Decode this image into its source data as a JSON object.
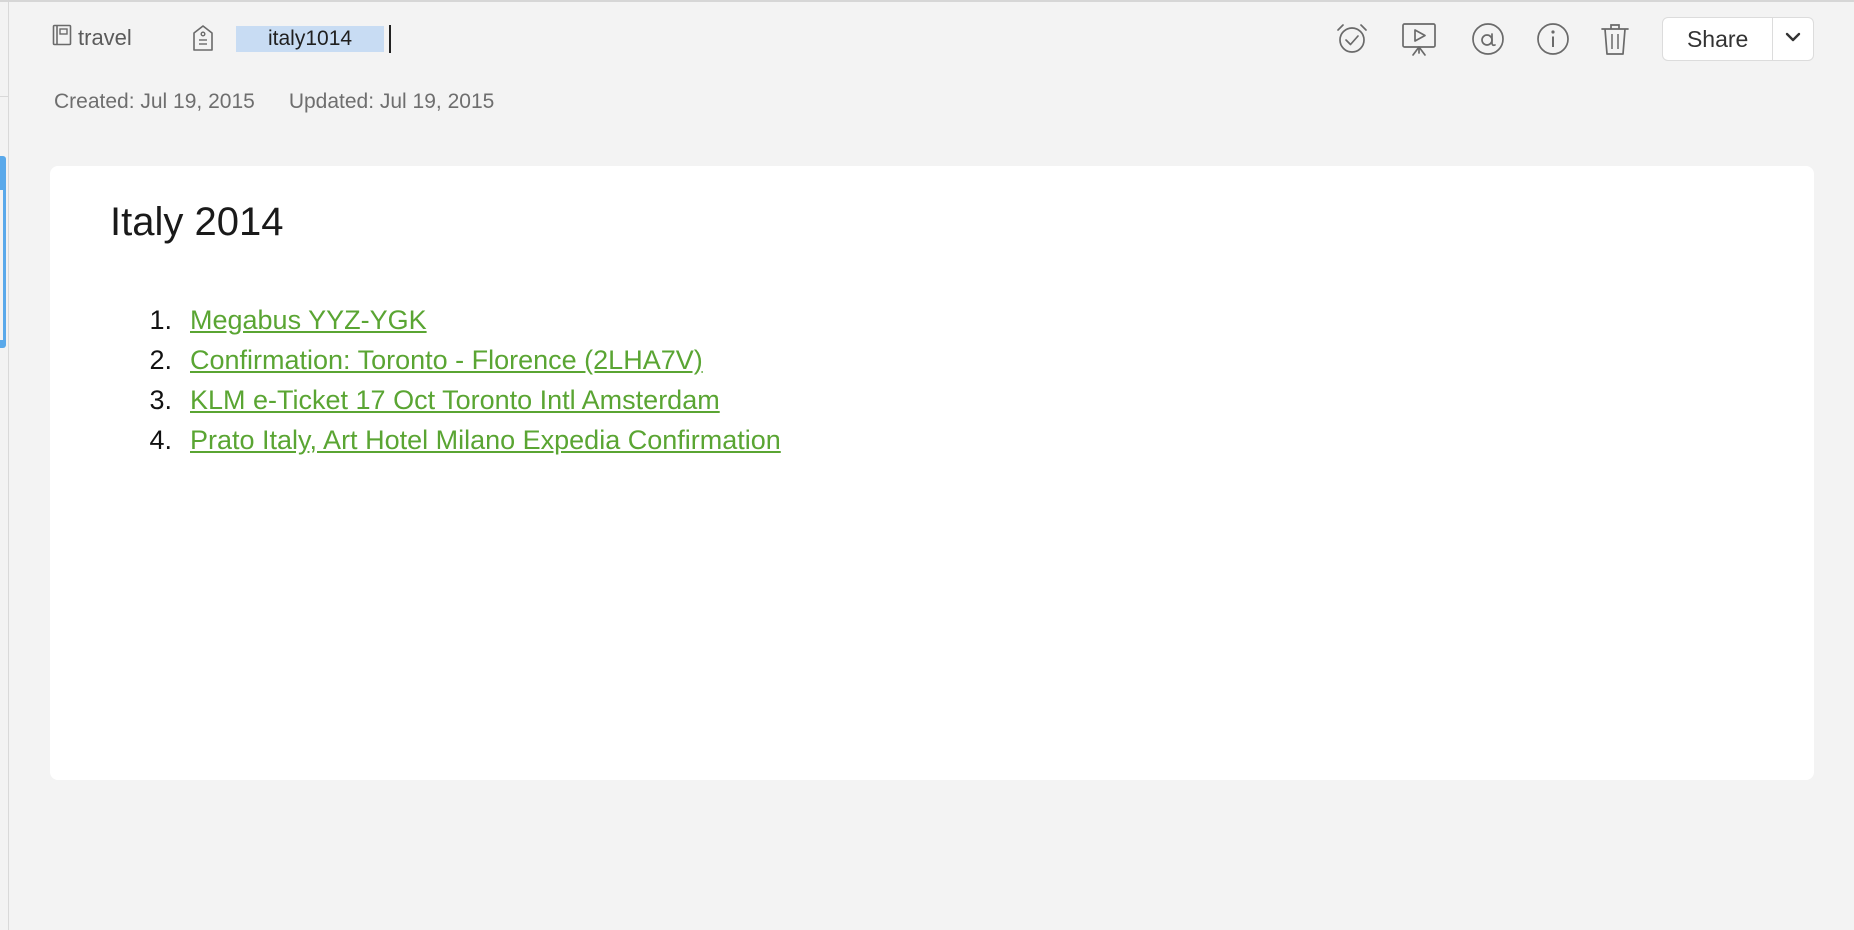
{
  "toolbar": {
    "notebook_label": "travel",
    "tag_value": "italy1014",
    "share_label": "Share"
  },
  "icons": {
    "notebook": "notebook-icon",
    "tag": "tag-icon",
    "reminder": "alarm-clock-icon",
    "presentation": "presentation-icon",
    "work_chat": "at-sign-icon",
    "info": "info-icon",
    "trash": "trash-icon",
    "share_menu": "chevron-down-icon"
  },
  "meta": {
    "created": "Created: Jul 19, 2015",
    "updated": "Updated: Jul 19, 2015"
  },
  "note": {
    "title": "Italy 2014",
    "items": [
      {
        "number": "1.",
        "text": "Megabus YYZ-YGK"
      },
      {
        "number": "2.",
        "text": "Confirmation: Toronto - Florence (2LHA7V)"
      },
      {
        "number": "3.",
        "text": "KLM e-Ticket 17 Oct Toronto Intl Amsterdam"
      },
      {
        "number": "4.",
        "text": "Prato Italy, Art Hotel Milano Expedia Confirmation"
      }
    ]
  },
  "colors": {
    "link": "#5aa533",
    "tag_highlight": "#c8dcf3",
    "background": "#f3f3f3",
    "card": "#ffffff",
    "accent_blue": "#5aa9ea"
  }
}
